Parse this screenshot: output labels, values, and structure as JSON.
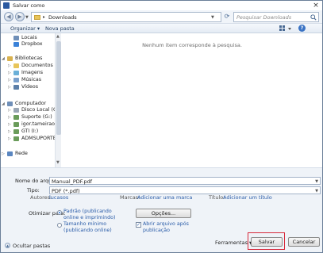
{
  "window": {
    "title": "Salvar como"
  },
  "address": {
    "path": "Downloads"
  },
  "search": {
    "placeholder": "Pesquisar Downloads"
  },
  "toolbar": {
    "organize": "Organizar ▾",
    "new_folder": "Nova pasta"
  },
  "nav": {
    "items": [
      {
        "label": "Locais",
        "icon": "recent-places-icon",
        "level": 1,
        "expander": ""
      },
      {
        "label": "Dropbox",
        "icon": "dropbox-icon",
        "level": 1,
        "expander": ""
      },
      {
        "label": "Bibliotecas",
        "icon": "libraries-icon",
        "level": 0,
        "expander": "▲"
      },
      {
        "label": "Documentos",
        "icon": "documents-icon",
        "level": 1,
        "expander": "▷"
      },
      {
        "label": "Imagens",
        "icon": "pictures-icon",
        "level": 1,
        "expander": "▷"
      },
      {
        "label": "Músicas",
        "icon": "music-icon",
        "level": 1,
        "expander": "▷"
      },
      {
        "label": "Vídeos",
        "icon": "videos-icon",
        "level": 1,
        "expander": "▷"
      },
      {
        "label": "Computador",
        "icon": "computer-icon",
        "level": 0,
        "expander": "▲"
      },
      {
        "label": "Disco Local (C:)",
        "icon": "local-disk-icon",
        "level": 1,
        "expander": "▷"
      },
      {
        "label": "Suporte (G:)",
        "icon": "network-drive-icon",
        "level": 1,
        "expander": "▷"
      },
      {
        "label": "igor.tameirao (\\\\",
        "icon": "network-drive-icon",
        "level": 1,
        "expander": "▷"
      },
      {
        "label": "GTI (I:)",
        "icon": "network-drive-icon",
        "level": 1,
        "expander": "▷"
      },
      {
        "label": "ADMSUPORTE (K",
        "icon": "network-drive-icon",
        "level": 1,
        "expander": "▷"
      },
      {
        "label": "Rede",
        "icon": "network-icon",
        "level": 0,
        "expander": "▷"
      }
    ]
  },
  "files": {
    "empty_message": "Nenhum item corresponde à pesquisa."
  },
  "form": {
    "filename_label": "Nome do arquivo:",
    "filename_value": "Manual_PDF.pdf",
    "type_label": "Tipo:",
    "type_value": "PDF (*.pdf)",
    "authors_label": "Autores:",
    "authors_value": "lucasos",
    "tags_label": "Marcas:",
    "tags_value": "Adicionar uma marca",
    "title_label": "Título:",
    "title_value": "Adicionar um título",
    "optimize_label": "Otimizar para:",
    "opt_standard": "Padrão (publicando",
    "opt_standard_2": "online e imprimindo)",
    "opt_minimum": "Tamanho mínimo",
    "opt_minimum_2": "(publicando online)",
    "options_button": "Opções...",
    "open_after_1": "Abrir arquivo após",
    "open_after_2": "publicação",
    "open_after_checked": true
  },
  "footer": {
    "hide_folders": "Ocultar pastas",
    "tools": "Ferramentas",
    "save": "Salvar",
    "cancel": "Cancelar"
  },
  "colors": {
    "link": "#2a5ca8",
    "highlight": "#d6283a",
    "folder": "#e8c55a"
  }
}
